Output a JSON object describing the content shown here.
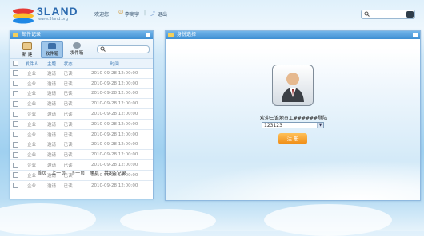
{
  "logo": {
    "word": "3LAND",
    "url": "www.3land.org"
  },
  "userbar": {
    "welcome": "欢迎您：",
    "user": "李商宇",
    "logout": "退出"
  },
  "left_panel": {
    "title": "邮件记录",
    "toolbar": [
      {
        "label": "新 建",
        "icon": "new-doc-icon",
        "active": false
      },
      {
        "label": "收件箱",
        "icon": "inbox-icon",
        "active": true
      },
      {
        "label": "发件箱",
        "icon": "outbox-icon",
        "active": false
      }
    ],
    "columns": [
      "发件人",
      "主题",
      "状态",
      "时间"
    ],
    "rows": [
      [
        "企业",
        "邀请",
        "已读",
        "2010-09-28 12:00:00"
      ],
      [
        "企业",
        "邀请",
        "已读",
        "2010-09-28 12:00:00"
      ],
      [
        "企业",
        "邀请",
        "已读",
        "2010-09-28 12:00:00"
      ],
      [
        "企业",
        "邀请",
        "已读",
        "2010-09-28 12:00:00"
      ],
      [
        "企业",
        "邀请",
        "已读",
        "2010-09-28 12:00:00"
      ],
      [
        "企业",
        "邀请",
        "已读",
        "2010-09-28 12:00:00"
      ],
      [
        "企业",
        "邀请",
        "已读",
        "2010-09-28 12:00:00"
      ],
      [
        "企业",
        "邀请",
        "已读",
        "2010-09-28 12:00:00"
      ],
      [
        "企业",
        "邀请",
        "已读",
        "2010-09-28 12:00:00"
      ],
      [
        "企业",
        "邀请",
        "已读",
        "2010-09-28 12:00:00"
      ],
      [
        "企业",
        "邀请",
        "已读",
        "2010-09-28 12:00:00"
      ],
      [
        "企业",
        "邀请",
        "已读",
        "2010-09-28 12:00:00"
      ]
    ],
    "pager": {
      "first": "首页",
      "prev": "上一页",
      "next": "下一页",
      "last": "尾页",
      "total": "共8条记录"
    }
  },
  "right_panel": {
    "title": "身份选择",
    "welcome": "欢迎三谁地员工######登陆",
    "select_value": "123123",
    "login_label": "注 册"
  },
  "colors": {
    "accent": "#3f8fd3",
    "login": "#ef8b13",
    "header_text": "#3c78b4"
  }
}
